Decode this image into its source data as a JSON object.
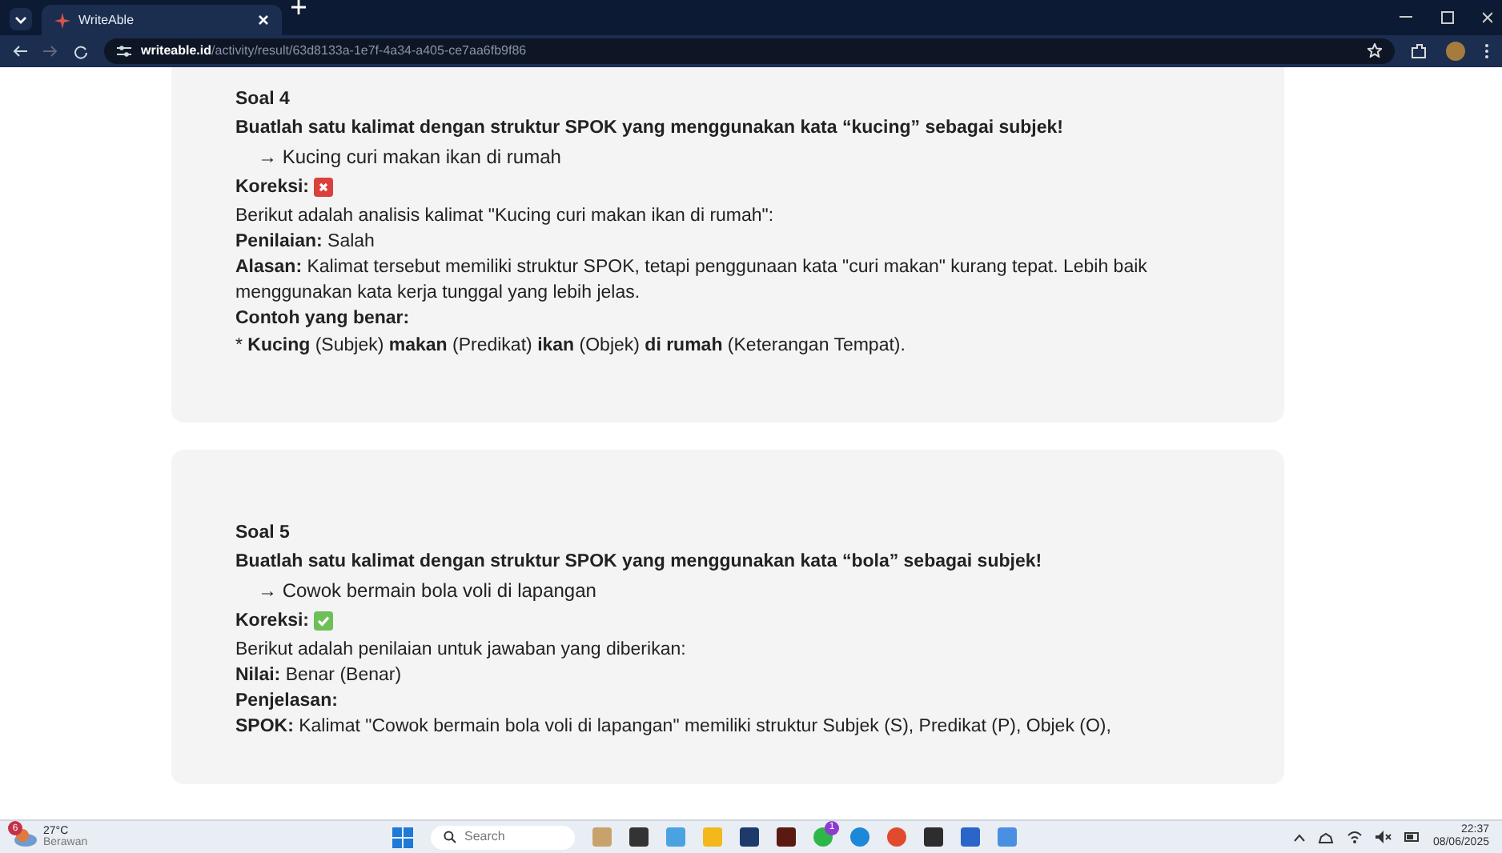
{
  "browser": {
    "tab_title": "WriteAble",
    "url_domain": "writeable.id",
    "url_path": "/activity/result/63d8133a-1e7f-4a34-a405-ce7aa6fb9f86"
  },
  "questions": [
    {
      "title": "Soal 4",
      "prompt": "Buatlah satu kalimat dengan struktur SPOK yang menggunakan kata “kucing” sebagai subjek!",
      "answer": "→ Kucing curi makan ikan di rumah",
      "correction_label": "Koreksi:",
      "correct": false,
      "lines": [
        {
          "kind": "text",
          "text": "Berikut adalah analisis kalimat \"Kucing curi makan ikan di rumah\":"
        },
        {
          "kind": "text",
          "text": "**Penilaian:** Salah"
        },
        {
          "kind": "text",
          "text": "**Alasan:** Kalimat tersebut memiliki struktur SPOK, tetapi penggunaan kata \"curi makan\" kurang tepat. Lebih baik menggunakan kata kerja tunggal yang lebih jelas."
        },
        {
          "kind": "heading",
          "text": "Contoh yang benar:"
        },
        {
          "kind": "text",
          "text": "* **Kucing** (Subjek) **makan** (Predikat) **ikan** (Objek) **di rumah** (Keterangan Tempat)."
        }
      ]
    },
    {
      "title": "Soal 5",
      "prompt": "Buatlah satu kalimat dengan struktur SPOK yang menggunakan kata “bola” sebagai subjek!",
      "answer": "→ Cowok bermain bola voli di lapangan",
      "correction_label": "Koreksi:",
      "correct": true,
      "lines": [
        {
          "kind": "text",
          "text": "Berikut adalah penilaian untuk jawaban yang diberikan:"
        },
        {
          "kind": "text",
          "text": "**Nilai:** Benar (Benar)"
        },
        {
          "kind": "heading",
          "text": "Penjelasan:"
        },
        {
          "kind": "text",
          "text": "**SPOK:** Kalimat \"Cowok bermain bola voli di lapangan\" memiliki struktur Subjek (S), Predikat (P), Objek (O),"
        }
      ]
    }
  ],
  "taskbar": {
    "weather_badge": "6",
    "temperature": "27°C",
    "weather": "Berawan",
    "search_placeholder": "Search",
    "app_badge": "1",
    "time": "22:37",
    "date": "08/06/2025"
  }
}
